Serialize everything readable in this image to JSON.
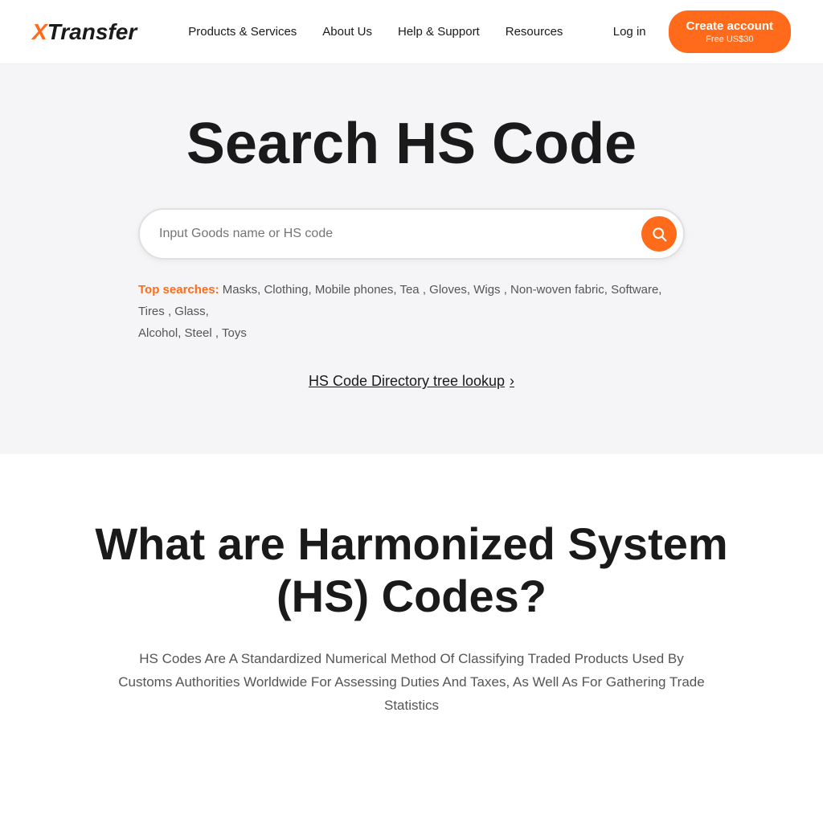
{
  "logo": {
    "text_x": "X",
    "text_transfer": "Transfer"
  },
  "nav": {
    "items": [
      {
        "id": "products-services",
        "label": "Products & Services"
      },
      {
        "id": "about-us",
        "label": "About Us"
      },
      {
        "id": "help-support",
        "label": "Help & Support"
      },
      {
        "id": "resources",
        "label": "Resources"
      }
    ]
  },
  "header": {
    "login_label": "Log in",
    "create_account_label": "Create account",
    "create_account_sub": "Free US$30"
  },
  "hero": {
    "title": "Search HS Code",
    "search_placeholder": "Input Goods name or HS code",
    "top_searches_label": "Top searches:",
    "top_searches": [
      "Masks",
      "Clothing",
      "Mobile phones",
      "Tea",
      "Gloves",
      "Wigs",
      "Non-woven fabric",
      "Software",
      "Tires",
      "Glass",
      "Alcohol",
      "Steel",
      "Toys"
    ],
    "directory_link": "HS Code Directory tree lookup"
  },
  "hs_info": {
    "title": "What are Harmonized System (HS) Codes?",
    "description": "HS Codes Are A Standardized Numerical Method Of Classifying Traded Products Used By Customs Authorities Worldwide For Assessing Duties And Taxes, As Well As For Gathering Trade Statistics"
  }
}
